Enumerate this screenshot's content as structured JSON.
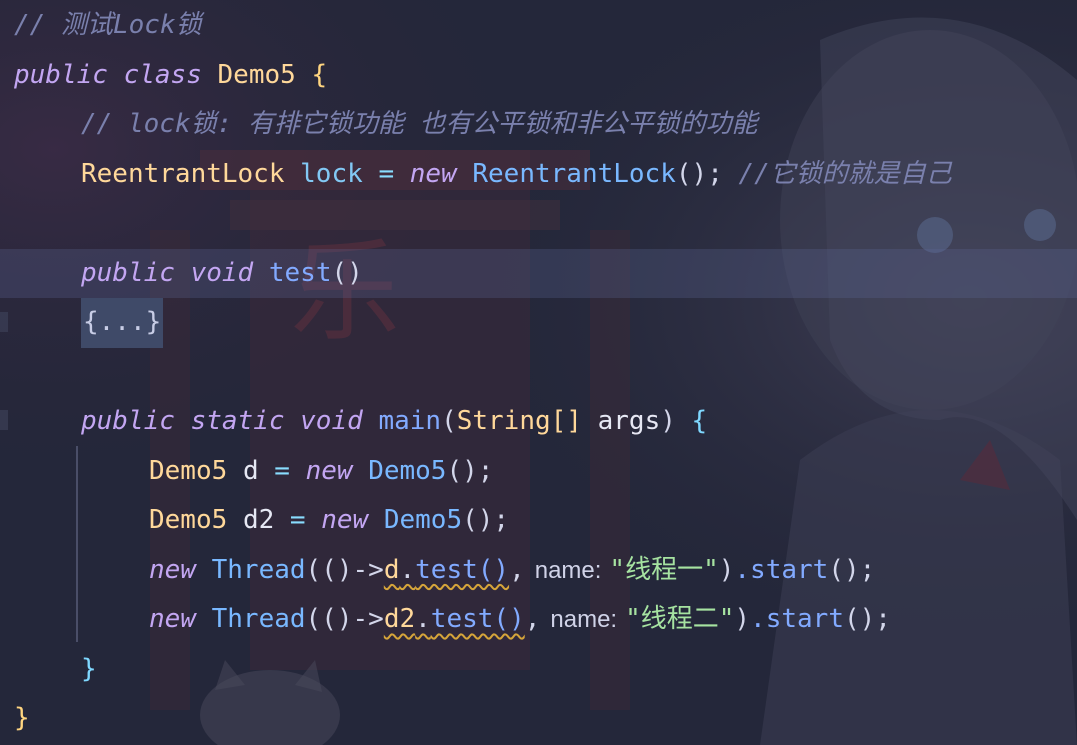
{
  "editor": {
    "lines": {
      "l1_comment": "// 测试Lock锁",
      "l2": {
        "kw_public": "public",
        "kw_class": "class",
        "class_name": "Demo5",
        "brace": "{"
      },
      "l3_comment": "// lock锁: 有排它锁功能 也有公平锁和非公平锁的功能",
      "l4": {
        "type": "ReentrantLock",
        "field": "lock",
        "eq": "=",
        "kw_new": "new",
        "ctor": "ReentrantLock",
        "paren": "()",
        "semi": ";",
        "comment": "//它锁的就是自己"
      },
      "l6": {
        "kw_public": "public",
        "kw_void": "void",
        "method": "test",
        "parens": "()"
      },
      "l7_folded": "{...}",
      "l9": {
        "kw_public": "public",
        "kw_static": "static",
        "kw_void": "void",
        "method": "main",
        "param_type": "String[]",
        "param": "args",
        "brace": "{"
      },
      "l10": {
        "type": "Demo5",
        "var": "d",
        "eq": "=",
        "kw_new": "new",
        "ctor": "Demo5",
        "tail": "();"
      },
      "l11": {
        "type": "Demo5",
        "var": "d2",
        "eq": "=",
        "kw_new": "new",
        "ctor": "Demo5",
        "tail": "();"
      },
      "l12": {
        "kw_new": "new",
        "ctor": "Thread",
        "lambda": "(()->",
        "target": "d",
        "dot": ".",
        "call": "test()",
        "comma": ",",
        "hint": "name:",
        "str": "\"线程一\"",
        "close": ")",
        "chain": ".start",
        "tail": "();"
      },
      "l13": {
        "kw_new": "new",
        "ctor": "Thread",
        "lambda": "(()->",
        "target": "d2",
        "dot": ".",
        "call": "test()",
        "comma": ",",
        "hint": "name:",
        "str": "\"线程二\"",
        "close": ")",
        "chain": ".start",
        "tail": "();"
      },
      "l14_brace": "}",
      "l15_brace": "}"
    }
  },
  "colors": {
    "background": "#232536",
    "comment": "#7a80ad",
    "keyword": "#c3a6f2",
    "class_name": "#ffd89a",
    "type": "#79b8ff",
    "string": "#a6e3a1",
    "current_line": "#3a3f5c"
  }
}
